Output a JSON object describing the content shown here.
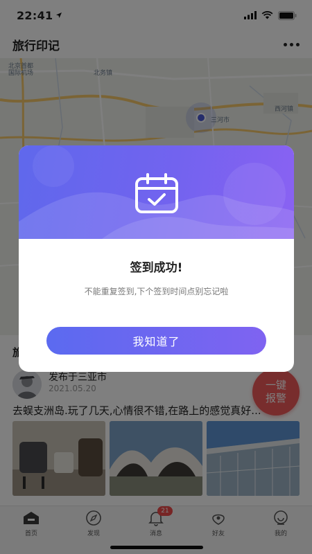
{
  "status_bar": {
    "time": "22:41"
  },
  "nav": {
    "title": "旅行印记"
  },
  "map": {
    "labels": [
      "北京首都",
      "国际机场",
      "北务镇",
      "三河市",
      "西河镇"
    ]
  },
  "feed": {
    "heading": "旅",
    "post": {
      "location": "发布于三亚市",
      "date": "2021.05.20",
      "text": "去蜈支洲岛.玩了几天,心情很不错,在路上的感觉真好..."
    }
  },
  "sos": {
    "line1": "一键",
    "line2": "报警"
  },
  "tabs": [
    {
      "label": "首页",
      "icon": "home-icon"
    },
    {
      "label": "发现",
      "icon": "compass-icon"
    },
    {
      "label": "消息",
      "icon": "bell-icon",
      "badge": "21"
    },
    {
      "label": "好友",
      "icon": "friends-icon"
    },
    {
      "label": "我的",
      "icon": "profile-icon"
    }
  ],
  "dialog": {
    "title": "签到成功!",
    "message": "不能重复签到,下个签到时间点别忘记啦",
    "confirm_label": "我知道了",
    "icon": "calendar-check-icon"
  },
  "colors": {
    "accent": "#6b66ef",
    "sos": "#f15a5a",
    "badge": "#ef4b4b"
  }
}
